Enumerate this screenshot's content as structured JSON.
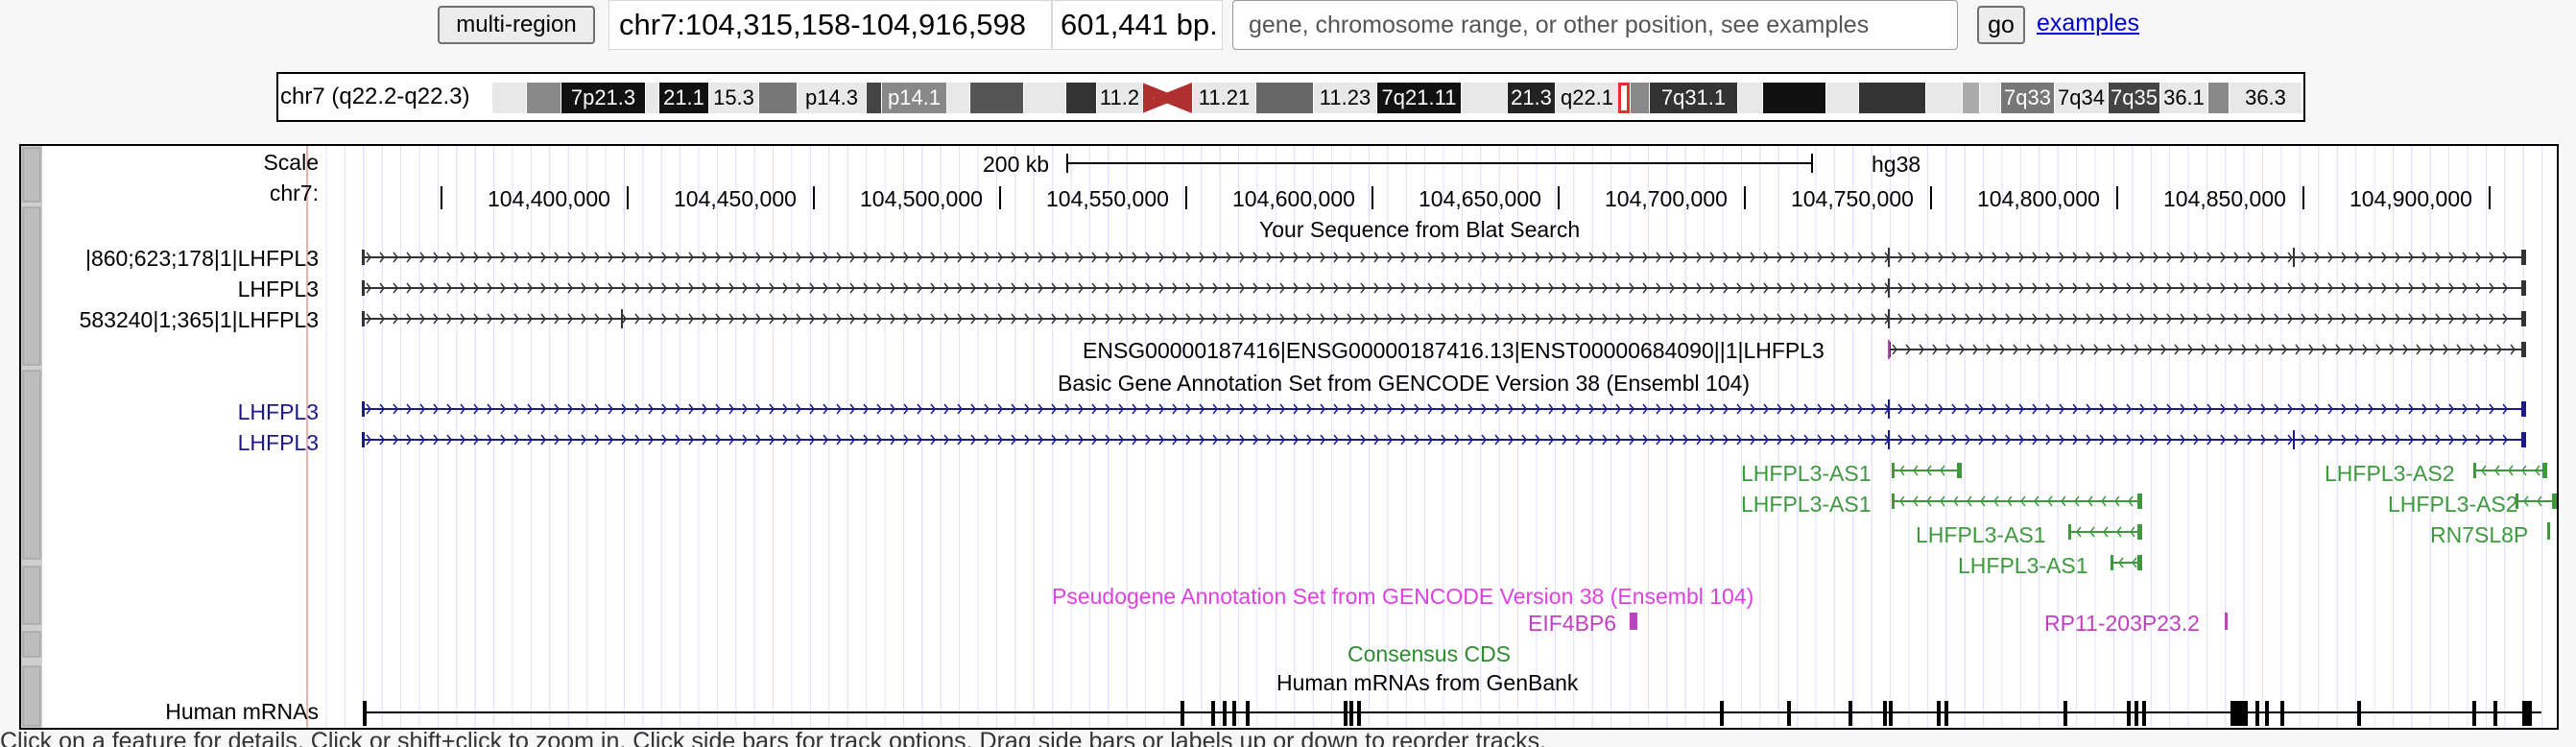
{
  "nav": {
    "multi_region_label": "multi-region",
    "position": "chr7:104,315,158-104,916,598",
    "size": "601,441 bp.",
    "search_placeholder": "gene, chromosome range, or other position, see examples",
    "go_label": "go",
    "examples_label": "examples"
  },
  "ideogram": {
    "label": "chr7 (q22.2-q22.3)",
    "bands": [
      "7p21.3",
      "21.1",
      "15.3",
      "p14.3",
      "p14.1",
      "11.2",
      "11.21",
      "11.23",
      "7q21.11",
      "21.3",
      "q22.1",
      "7q31.1",
      "7q33",
      "7q34",
      "7q35",
      "36.1",
      "36.3"
    ],
    "highlight_color": "#e03030"
  },
  "ruler": {
    "scale_label": "Scale",
    "chrom_label": "chr7:",
    "scale_text": "200 kb",
    "assembly": "hg38",
    "ticks": [
      "104,400,000",
      "104,450,000",
      "104,500,000",
      "104,550,000",
      "104,600,000",
      "104,650,000",
      "104,700,000",
      "104,750,000",
      "104,800,000",
      "104,850,000",
      "104,900,000"
    ]
  },
  "blat": {
    "title": "Your Sequence from Blat Search",
    "labels": [
      "|860;623;178|1|LHFPL3",
      "LHFPL3",
      "583240|1;365|1|LHFPL3"
    ],
    "row4_label": "ENSG00000187416|ENSG00000187416.13|ENST00000684090||1|LHFPL3"
  },
  "gencode": {
    "title": "Basic Gene Annotation Set from GENCODE Version 38 (Ensembl 104)",
    "labels": [
      "LHFPL3",
      "LHFPL3"
    ],
    "antisense": [
      "LHFPL3-AS1",
      "LHFPL3-AS1",
      "LHFPL3-AS1",
      "LHFPL3-AS1",
      "LHFPL3-AS2",
      "LHFPL3-AS2",
      "RN7SL8P"
    ],
    "color": "#1a1a8c",
    "antisense_color": "#3c9a3c"
  },
  "pseudo": {
    "title": "Pseudogene Annotation Set from GENCODE Version 38 (Ensembl 104)",
    "items": [
      "EIF4BP6",
      "RP11-203P23.2"
    ],
    "color": "#c040c0"
  },
  "ccds": {
    "title": "Consensus CDS",
    "color": "#2e8b2e"
  },
  "mrna": {
    "title": "Human mRNAs from GenBank",
    "label": "Human mRNAs"
  },
  "hint": "Click on a feature for details. Click or shift+click to zoom in. Click side bars for track options. Drag side bars or labels up or down to reorder tracks."
}
